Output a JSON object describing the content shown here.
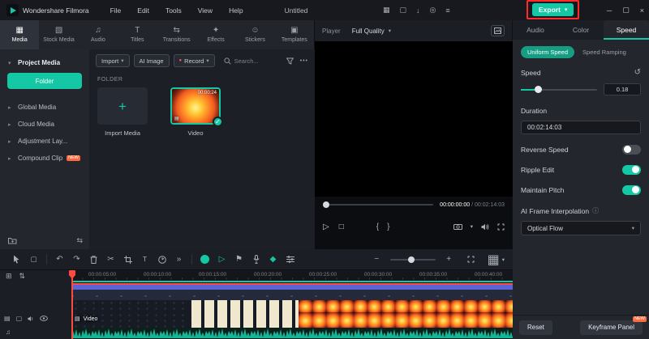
{
  "colors": {
    "accent": "#14c8a6",
    "badge": "#ff6a3c",
    "annotation": "#ff2b2b",
    "playhead": "#ff4a3d"
  },
  "icons": {
    "chevron_down": "▾",
    "chevron_right": "▸",
    "plus": "+",
    "minus": "−",
    "dots": "•••",
    "undo": "↶",
    "redo": "↷",
    "scissors": "✂",
    "text_tool": "T",
    "more_chevrons": "»",
    "record_dot": "●",
    "play": "▷",
    "stop": "□",
    "bracket_in": "{",
    "bracket_out": "}",
    "check": "✓",
    "info": "ⓘ",
    "reset_arrow": "↺",
    "flag": "⚑",
    "keyframe": "◆",
    "grid": "▦",
    "film": "▤",
    "note": "♫",
    "box": "▢",
    "swap": "⇆",
    "updown": "⇅",
    "add_box": "⊞",
    "layout": "▦",
    "download": "↓",
    "ring": "◎",
    "lines": "≡",
    "win_min": "─",
    "win_max": "▢",
    "win_close": "×"
  },
  "titlebar": {
    "app_title": "Wondershare Filmora",
    "menus": [
      "File",
      "Edit",
      "Tools",
      "View",
      "Help"
    ],
    "project_title": "Untitled",
    "export_label": "Export"
  },
  "media_panel": {
    "tabs": [
      {
        "label": "Media",
        "glyph": "▦"
      },
      {
        "label": "Stock Media",
        "glyph": "▧"
      },
      {
        "label": "Audio",
        "glyph": "♫"
      },
      {
        "label": "Titles",
        "glyph": "T"
      },
      {
        "label": "Transitions",
        "glyph": "⇆"
      },
      {
        "label": "Effects",
        "glyph": "✦"
      },
      {
        "label": "Stickers",
        "glyph": "☺"
      },
      {
        "label": "Templates",
        "glyph": "▣"
      }
    ],
    "sidebar": [
      {
        "label": "Project Media"
      },
      {
        "label": "Folder"
      },
      {
        "label": "Global Media"
      },
      {
        "label": "Cloud Media"
      },
      {
        "label": "Adjustment Lay..."
      },
      {
        "label": "Compound Clip",
        "badge": "NEW"
      }
    ],
    "toolbar": {
      "import": "Import",
      "ai_image": "AI Image",
      "record": "Record",
      "search_placeholder": "Search..."
    },
    "section_title": "FOLDER",
    "items": [
      {
        "label": "Import Media"
      },
      {
        "label": "Video",
        "duration": "00:00:24"
      }
    ]
  },
  "player": {
    "label": "Player",
    "quality": "Full Quality",
    "current_time": "00:00:00:00",
    "separator": "/",
    "total_time": "00:02:14:03"
  },
  "inspector": {
    "tabs": [
      "Audio",
      "Color",
      "Speed"
    ],
    "active_tab": "Speed",
    "subtabs": [
      "Uniform Speed",
      "Speed Ramping"
    ],
    "speed": {
      "label": "Speed",
      "value": "0.18"
    },
    "duration": {
      "label": "Duration",
      "value": "00:02:14:03"
    },
    "toggles": [
      {
        "label": "Reverse Speed",
        "on": false
      },
      {
        "label": "Ripple Edit",
        "on": true
      },
      {
        "label": "Maintain Pitch",
        "on": true
      }
    ],
    "interpolation": {
      "label": "AI Frame Interpolation",
      "value": "Optical Flow"
    },
    "footer": {
      "reset": "Reset",
      "keyframe_panel": "Keyframe Panel",
      "badge": "NEW"
    }
  },
  "timeline": {
    "ruler": [
      "00:00:05:00",
      "00:00:10:00",
      "00:00:15:00",
      "00:00:20:00",
      "00:00:25:00",
      "00:00:30:00",
      "00:00:35:00",
      "00:00:40:00"
    ],
    "video_label": "Video"
  }
}
